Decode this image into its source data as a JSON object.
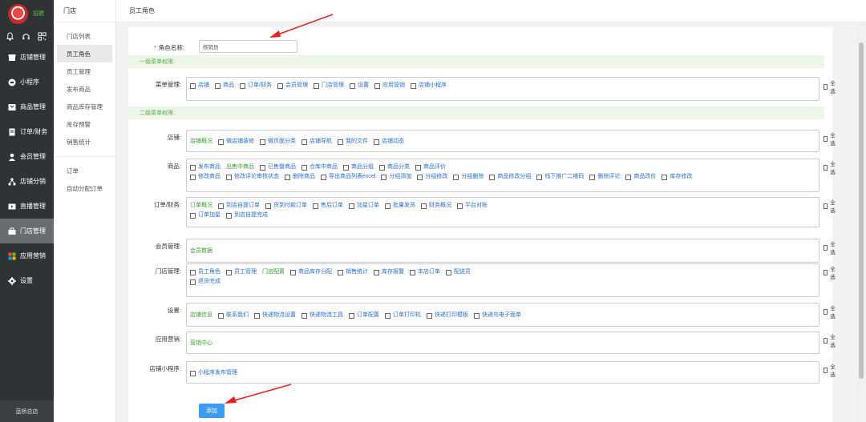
{
  "sidebar": {
    "brand": "招聘",
    "items": [
      {
        "label": "店铺管理",
        "icon": "store-icon"
      },
      {
        "label": "小程序",
        "icon": "miniprogram-icon"
      },
      {
        "label": "商品管理",
        "icon": "goods-icon"
      },
      {
        "label": "订单/财务",
        "icon": "order-icon"
      },
      {
        "label": "会员管理",
        "icon": "member-icon"
      },
      {
        "label": "店铺分销",
        "icon": "distribution-icon"
      },
      {
        "label": "直播管理",
        "icon": "live-icon"
      },
      {
        "label": "门店管理",
        "icon": "shop-icon"
      },
      {
        "label": "应用营销",
        "icon": "apps-icon"
      },
      {
        "label": "设置",
        "icon": "gear-icon"
      }
    ],
    "footer": "蓝桥总店"
  },
  "subnav": {
    "title": "门店",
    "items": [
      "门店列表",
      "员工角色",
      "员工管理",
      "发布商品",
      "商品库存管理",
      "库存预警",
      "销售统计"
    ],
    "items2": [
      "订单",
      "自动分配订单"
    ]
  },
  "topbar": {
    "title": "员工角色"
  },
  "form": {
    "role_label": "角色名称:",
    "role_value": "核销员",
    "section1": "一级菜单权限:",
    "section2": "二级菜单权限:",
    "all_label": "全选",
    "add_button": "添加",
    "menu": {
      "label": "菜单管理:",
      "rows": [
        [
          "店铺",
          "商品",
          "订单/财务",
          "会员管理",
          "门店管理",
          "设置",
          "应用营销",
          "店铺小程序"
        ]
      ]
    },
    "groups": [
      {
        "label": "店铺:",
        "rows": [
          [
            {
              "t": "店铺概况",
              "cb": false
            },
            {
              "t": "微店铺装修",
              "cb": true
            },
            {
              "t": "微页面分类",
              "cb": true
            },
            {
              "t": "店铺导航",
              "cb": true
            },
            {
              "t": "我的文件",
              "cb": true
            },
            {
              "t": "店铺动态",
              "cb": true
            }
          ]
        ]
      },
      {
        "label": "商品:",
        "rows": [
          [
            {
              "t": "发布商品",
              "cb": true
            },
            {
              "t": "出售中商品",
              "cb": false
            },
            {
              "t": "已售罄商品",
              "cb": true
            },
            {
              "t": "仓库中商品",
              "cb": true
            },
            {
              "t": "商品分组",
              "cb": true
            },
            {
              "t": "商品分类",
              "cb": true
            },
            {
              "t": "商品评价",
              "cb": true
            }
          ],
          [
            {
              "t": "修改商品",
              "cb": true
            },
            {
              "t": "修改评论审核状态",
              "cb": true
            },
            {
              "t": "删除商品",
              "cb": true
            },
            {
              "t": "导出商品列表excel",
              "cb": true
            },
            {
              "t": "分组添加",
              "cb": true
            },
            {
              "t": "分组修改",
              "cb": true
            },
            {
              "t": "分组删除",
              "cb": true
            },
            {
              "t": "商品修改分组",
              "cb": true
            },
            {
              "t": "线下推广二维码",
              "cb": true
            },
            {
              "t": "删除评论",
              "cb": true
            },
            {
              "t": "商品改价",
              "cb": true
            },
            {
              "t": "库存修改",
              "cb": true
            }
          ]
        ]
      },
      {
        "label": "订单/财务:",
        "rows": [
          [
            {
              "t": "订单概况",
              "cb": false
            },
            {
              "t": "到店自提订单",
              "cb": true
            },
            {
              "t": "货到付款订单",
              "cb": true
            },
            {
              "t": "售后订单",
              "cb": true
            },
            {
              "t": "加星订单",
              "cb": true
            },
            {
              "t": "批量发货",
              "cb": true
            },
            {
              "t": "财务概况",
              "cb": true
            },
            {
              "t": "平台对账",
              "cb": true
            }
          ],
          [
            {
              "t": "订单加星",
              "cb": true
            },
            {
              "t": "到店自提完成",
              "cb": true
            }
          ]
        ]
      },
      {
        "label": "会员管理:",
        "rows": [
          [
            {
              "t": "会员数据",
              "cb": false
            }
          ]
        ]
      },
      {
        "label": "门店管理:",
        "rows": [
          [
            {
              "t": "员工角色",
              "cb": true
            },
            {
              "t": "员工管理",
              "cb": true
            },
            {
              "t": "门店配置",
              "cb": false
            },
            {
              "t": "商品库存分配",
              "cb": true
            },
            {
              "t": "销售统计",
              "cb": true
            },
            {
              "t": "库存报警",
              "cb": true
            },
            {
              "t": "本店订单",
              "cb": true
            },
            {
              "t": "配送员",
              "cb": true
            }
          ],
          [
            {
              "t": "退货完成",
              "cb": true
            }
          ]
        ]
      },
      {
        "label": "设置:",
        "rows": [
          [
            {
              "t": "店铺信息",
              "cb": false
            },
            {
              "t": "联系我们",
              "cb": true
            },
            {
              "t": "快递物流设置",
              "cb": true
            },
            {
              "t": "快递物流工具",
              "cb": true
            },
            {
              "t": "订单配置",
              "cb": true
            },
            {
              "t": "订单打印机",
              "cb": true
            },
            {
              "t": "快递打印模板",
              "cb": true
            },
            {
              "t": "快递鸟电子面单",
              "cb": true
            }
          ]
        ]
      },
      {
        "label": "应用营销:",
        "rows": [
          [
            {
              "t": "营销中心",
              "cb": false
            }
          ]
        ]
      },
      {
        "label": "店铺小程序:",
        "rows": [
          [
            {
              "t": "小程序发布管理",
              "cb": true
            }
          ]
        ]
      }
    ]
  }
}
